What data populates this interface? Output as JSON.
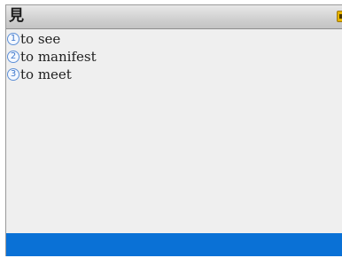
{
  "header": {
    "title": "見",
    "corner_icon": "yellow-badge-icon"
  },
  "items": [
    {
      "number": "1",
      "text": "to see"
    },
    {
      "number": "2",
      "text": "to manifest"
    },
    {
      "number": "3",
      "text": "to meet"
    }
  ],
  "colors": {
    "window_bg": "#efefef",
    "footer_bar": "#0a71d6",
    "badge_outline": "#5d8fd6"
  }
}
